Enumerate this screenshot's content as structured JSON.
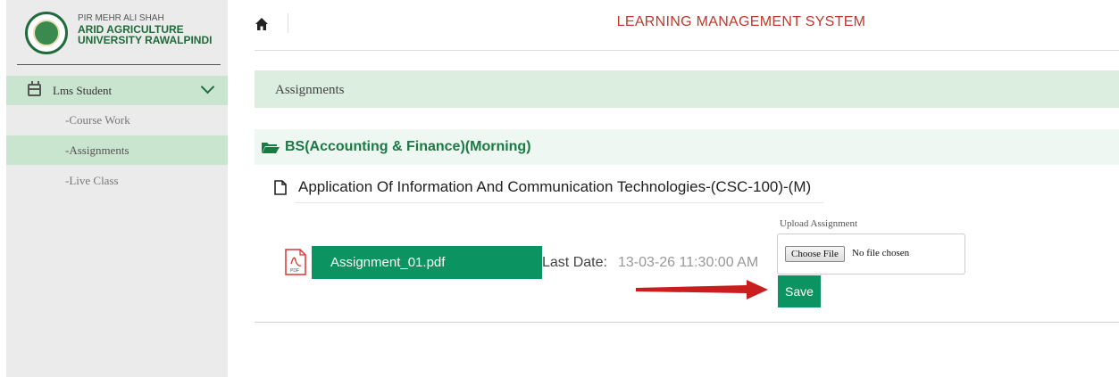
{
  "sidebar": {
    "logo_line1": "PIR MEHR ALI SHAH",
    "logo_line2": "ARID AGRICULTURE",
    "logo_line3": "UNIVERSITY RAWALPINDI",
    "menu_parent": "Lms Student",
    "items": [
      {
        "label": "-Course Work",
        "active": false
      },
      {
        "label": "-Assignments",
        "active": true
      },
      {
        "label": "-Live Class",
        "active": false
      }
    ]
  },
  "header": {
    "title": "LEARNING MANAGEMENT SYSTEM"
  },
  "page": {
    "breadcrumb": "Assignments",
    "program": "BS(Accounting & Finance)(Morning)",
    "course": "Application Of Information And Communication Technologies-(CSC-100)-(M)"
  },
  "assignment": {
    "file_name": "Assignment_01.pdf",
    "last_date_label": "Last Date:",
    "last_date_value": "13-03-26 11:30:00 AM",
    "upload_label": "Upload Assignment",
    "choose_file": "Choose File",
    "no_file": "No file chosen",
    "save": "Save"
  },
  "colors": {
    "accent": "#0b9361",
    "title_red": "#c0392b",
    "arrow_red": "#c81e1e"
  },
  "icons": [
    "home-icon",
    "calendar-icon",
    "chevron-down-icon",
    "folder-open-icon",
    "document-icon",
    "pdf-icon",
    "arrow-right-icon"
  ]
}
